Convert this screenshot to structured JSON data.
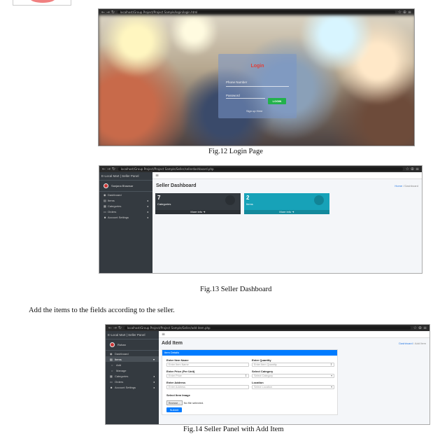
{
  "fig12": {
    "url": "localhost/Group Project/Project Sample/login/login.html",
    "login_title": "Login",
    "phone_label": "Phone Number",
    "password_label": "Password",
    "login_button": "LOGIN",
    "signup_link": "Sign up Here",
    "caption": "Fig.12 Login Page"
  },
  "fig13": {
    "url": "localhost/Group Project/Project Sample/Seller/sellerdashboard.php",
    "brand": "E-Local Mart | Seller Panel",
    "user": "Sanjana Bhawsar",
    "menu": [
      "Dashboard",
      "Items",
      "Categories",
      "Orders",
      "Account Settings"
    ],
    "page_title": "Seller Dashboard",
    "breadcrumb_home": "Home",
    "breadcrumb_current": "Dashboard",
    "box1": {
      "value": "7",
      "label": "Categories",
      "more": "More info"
    },
    "box2": {
      "value": "2",
      "label": "Items",
      "more": "More info"
    },
    "caption": "Fig.13 Seller Dashboard"
  },
  "paragraph": "Add the items to the fields according to the seller.",
  "fig14": {
    "url": "localhost/Group Project/Project Sample/Seller/add-item.php",
    "brand": "E-Local Mart | Seller Panel",
    "user": "Rohan",
    "menu": [
      "Dashboard",
      "Items",
      "Add",
      "Manage",
      "Categories",
      "Orders",
      "Account Settings"
    ],
    "page_title": "Add Item",
    "breadcrumb_home": "Dashboard",
    "breadcrumb_current": "Add Item",
    "card_header": "Item Details",
    "fields": {
      "name_label": "Enter Item Name",
      "name_ph": "Enter Item Name",
      "qty_label": "Enter Quantity",
      "qty_ph": "Enter Item Quantity",
      "price_label": "Enter Price (Per Unit)",
      "price_ph": "Enter Price",
      "cat_label": "Select Category",
      "cat_value": "Select Category",
      "addr_label": "Enter Address",
      "addr_ph": "Enter Address",
      "loc_label": "Location",
      "loc_value": "Select Location",
      "image_label": "Select Item Image",
      "browse": "Browse...",
      "no_file": "No file selected."
    },
    "submit": "Submit",
    "caption": "Fig.14 Seller Panel with Add Item"
  }
}
